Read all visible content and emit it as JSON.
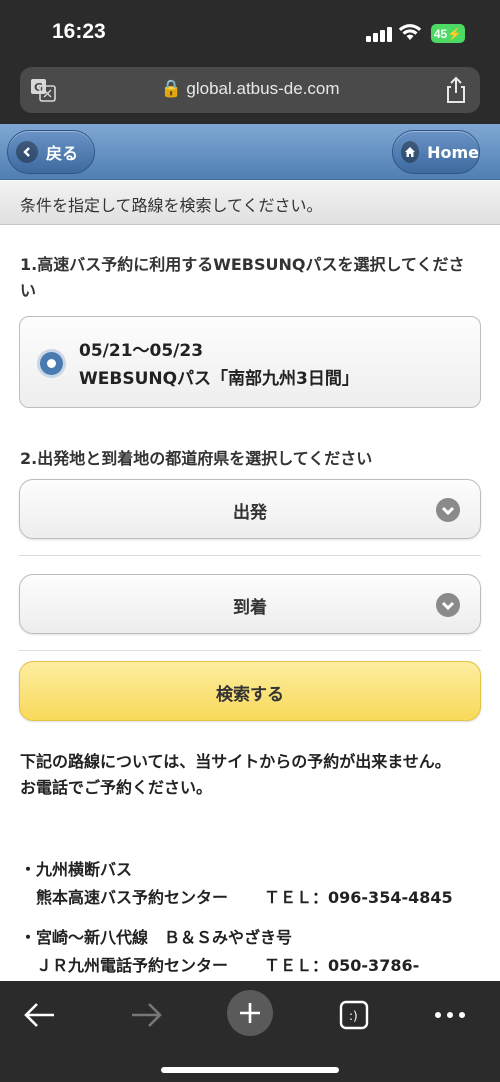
{
  "status_bar": {
    "time": "16:23",
    "battery": "45"
  },
  "browser": {
    "url": "global.atbus-de.com"
  },
  "header": {
    "back_label": "戻る",
    "home_label": "Home"
  },
  "instruction": "条件を指定して路線を検索してください。",
  "step1": {
    "label": "1.高速バス予約に利用するWEBSUNQパスを選択してください",
    "pass_dates": "05/21〜05/23",
    "pass_name": "WEBSUNQパス「南部九州3日間」"
  },
  "step2": {
    "label": "2.出発地と到着地の都道府県を選択してください",
    "departure": "出発",
    "arrival": "到着"
  },
  "search_label": "検索する",
  "notice": {
    "line1": "下記の路線については、当サイトからの予約が出来ません。",
    "line2": "お電話でご予約ください。"
  },
  "routes": [
    {
      "name": "・九州横断バス",
      "center": "熊本高速バス予約センター",
      "tel": "ＴＥＬ：096-354-4845"
    },
    {
      "name": "・宮崎〜新八代線　Ｂ＆Ｓみやざき号",
      "center": "ＪＲ九州電話予約センター",
      "tel": "ＴＥＬ：050-3786-"
    }
  ]
}
